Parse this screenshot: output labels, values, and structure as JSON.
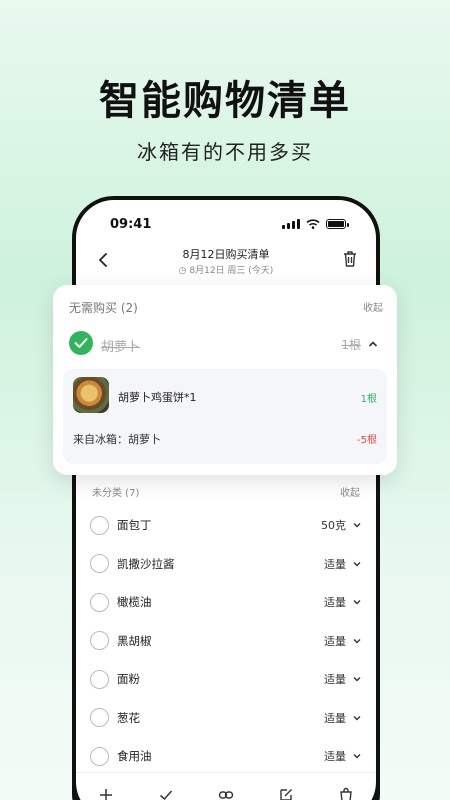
{
  "hero": {
    "title": "智能购物清单",
    "subtitle": "冰箱有的不用多买"
  },
  "status_bar": {
    "time": "09:41"
  },
  "nav": {
    "title": "8月12日购买清单",
    "subtitle": "8月12日 周三 (今天)"
  },
  "card": {
    "header": "无需购买 (2)",
    "collapse_label": "收起",
    "item": {
      "name": "胡萝卜",
      "qty": "1根"
    },
    "recipe": {
      "name": "胡萝卜鸡蛋饼*1",
      "qty": "1根"
    },
    "fridge": {
      "label": "来自冰箱：胡萝卜",
      "qty": "-5根"
    }
  },
  "uncategorized": {
    "header": "未分类 (7)",
    "collapse_label": "收起",
    "items": [
      {
        "name": "面包丁",
        "qty": "50克"
      },
      {
        "name": "凯撒沙拉酱",
        "qty": "适量"
      },
      {
        "name": "橄榄油",
        "qty": "适量"
      },
      {
        "name": "黑胡椒",
        "qty": "适量"
      },
      {
        "name": "面粉",
        "qty": "适量"
      },
      {
        "name": "葱花",
        "qty": "适量"
      },
      {
        "name": "食用油",
        "qty": "适量"
      }
    ]
  },
  "toolbar": {
    "icons": [
      "plus-icon",
      "check-icon",
      "link-icon",
      "edit-icon",
      "bag-icon"
    ]
  },
  "colors": {
    "accent_green": "#31b45c",
    "negative_red": "#e04848"
  }
}
